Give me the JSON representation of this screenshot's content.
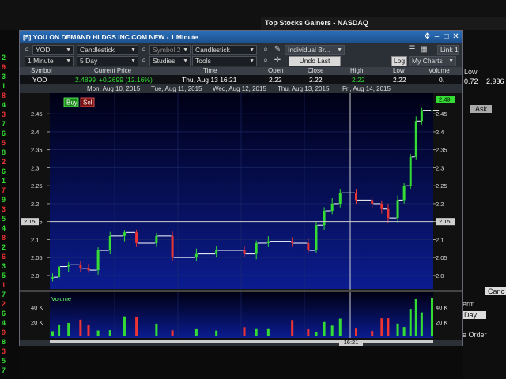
{
  "background": {
    "window_title": "Top Stocks Gainers - NASDAQ",
    "left_list_numbers": [
      "2",
      "9",
      "3",
      "1",
      "8",
      "4",
      "3",
      "7",
      "6",
      "5",
      "8",
      "2",
      "6",
      "1",
      "7",
      "9",
      "3",
      "5",
      "4",
      "8",
      "2",
      "6",
      "3",
      "5",
      "1",
      "7",
      "2",
      "6",
      "4",
      "9",
      "8",
      "3",
      "5",
      "7"
    ],
    "right_panel": {
      "low_label": "Low",
      "low_value": "0.72",
      "val2": "2,936",
      "ask_label": "Ask",
      "term_label": "erm",
      "day_label": "Day",
      "order_label": "e Order",
      "cancel_label": "Canc"
    }
  },
  "window": {
    "title": "[5] YOU ON DEMAND HLDGS INC COM NEW - 1 Minute",
    "controls": {
      "symbol": "YOD",
      "chart_type_1": "Candlestick",
      "symbol2_placeholder": "Symbol 2",
      "chart_type_2": "Candlestick",
      "broker": "Individual Br...",
      "link": "Link 1",
      "interval": "1 Minute",
      "range": "5 Day",
      "studies": "Studies",
      "tools": "Tools",
      "undo": "Undo Last",
      "log": "Log",
      "my_charts": "My Charts"
    },
    "quote_headers": [
      "Symbol",
      "Current Price",
      "Time",
      "Open",
      "Close",
      "High",
      "Low",
      "Volume"
    ],
    "quote": {
      "symbol": "YOD",
      "price": "2.4899",
      "change": "+0.2699 (12.16%)",
      "time": "Thu, Aug 13  16:21",
      "open": "2.22",
      "close": "2.22",
      "high": "2.22",
      "low": "2.22",
      "volume": "0."
    },
    "date_labels": [
      "Mon, Aug 10, 2015",
      "Tue, Aug 11, 2015",
      "Wed, Aug 12, 2015",
      "Thu, Aug 13, 2015",
      "Fri, Aug 14, 2015"
    ]
  },
  "chart_data": {
    "type": "candlestick",
    "y_ticks": [
      "2.45",
      "2.4",
      "2.35",
      "2.3",
      "2.25",
      "2.2",
      "2.15",
      "2.1",
      "2.05",
      "2.0"
    ],
    "ylim": [
      1.98,
      2.49
    ],
    "crosshair_price": "2.15",
    "current_price_tag": "2.49",
    "crosshair_time": "16:21",
    "buy_label": "Buy",
    "sell_label": "Sell",
    "volume_label": "Volume",
    "volume_ticks": [
      "40 K",
      "20 K"
    ],
    "colors": {
      "up": "#33dd33",
      "down": "#ee3333",
      "bg_top": "#000010",
      "bg_bottom": "#0a1a8a",
      "crosshair": "#cccccc"
    },
    "steps": [
      {
        "x": 0,
        "y": 1.995
      },
      {
        "x": 8,
        "y": 2.025
      },
      {
        "x": 20,
        "y": 2.03
      },
      {
        "x": 35,
        "y": 2.02
      },
      {
        "x": 45,
        "y": 2.015
      },
      {
        "x": 57,
        "y": 2.07
      },
      {
        "x": 72,
        "y": 2.11
      },
      {
        "x": 90,
        "y": 2.12
      },
      {
        "x": 105,
        "y": 2.09
      },
      {
        "x": 130,
        "y": 2.11
      },
      {
        "x": 150,
        "y": 2.05
      },
      {
        "x": 180,
        "y": 2.06
      },
      {
        "x": 205,
        "y": 2.07
      },
      {
        "x": 240,
        "y": 2.06
      },
      {
        "x": 255,
        "y": 2.09
      },
      {
        "x": 270,
        "y": 2.095
      },
      {
        "x": 300,
        "y": 2.09
      },
      {
        "x": 320,
        "y": 2.07
      },
      {
        "x": 330,
        "y": 2.14
      },
      {
        "x": 340,
        "y": 2.18
      },
      {
        "x": 350,
        "y": 2.2
      },
      {
        "x": 360,
        "y": 2.23
      },
      {
        "x": 380,
        "y": 2.21
      },
      {
        "x": 400,
        "y": 2.2
      },
      {
        "x": 412,
        "y": 2.185
      },
      {
        "x": 420,
        "y": 2.16
      },
      {
        "x": 432,
        "y": 2.21
      },
      {
        "x": 440,
        "y": 2.25
      },
      {
        "x": 448,
        "y": 2.33
      },
      {
        "x": 455,
        "y": 2.43
      },
      {
        "x": 462,
        "y": 2.46
      },
      {
        "x": 475,
        "y": 2.46
      }
    ]
  }
}
